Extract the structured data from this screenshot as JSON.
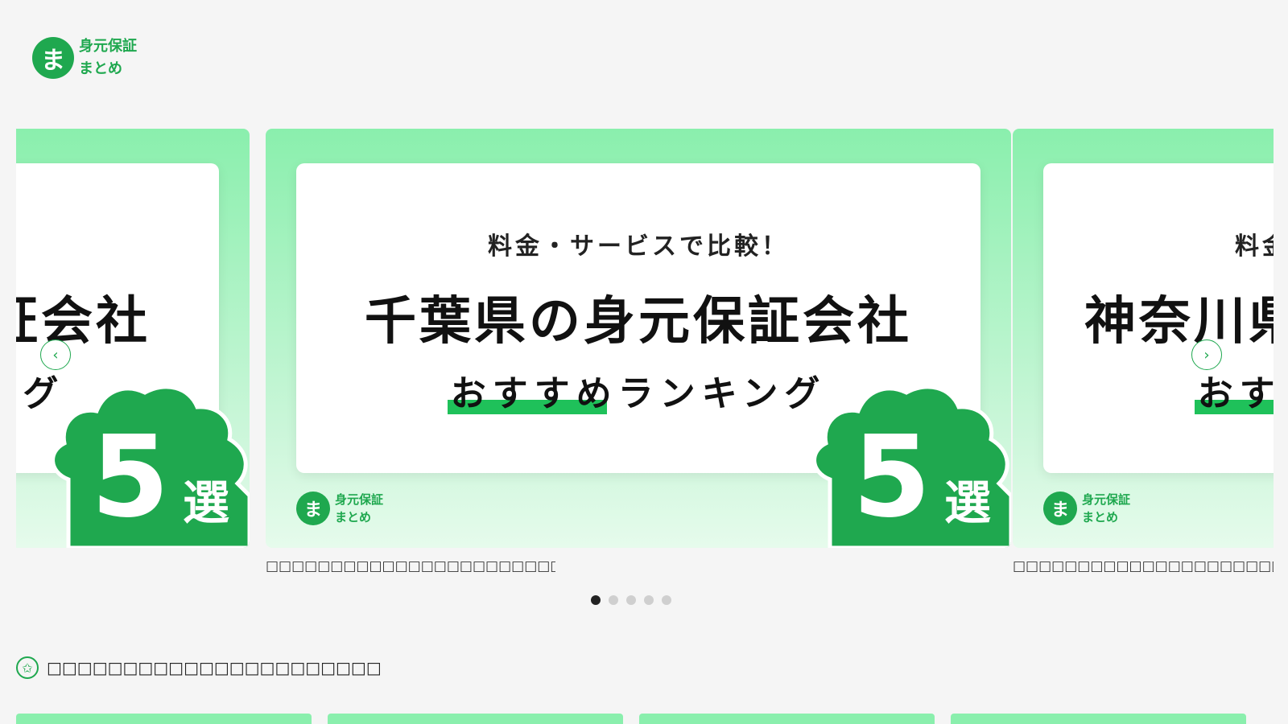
{
  "header": {
    "logo_mark": "ま",
    "logo_line1": "身元保証",
    "logo_line2": "まとめ"
  },
  "carousel": {
    "prev_icon": "‹",
    "next_icon": "›",
    "slides": [
      {
        "sub": "料金・サービスで比較！",
        "headline": "千葉県の身元保証会社",
        "ranking": "おすすめランキング",
        "badge_number": "5",
        "badge_text": "選",
        "logo_mark": "ま",
        "logo_line1": "身元保証",
        "logo_line2": "まとめ",
        "caption": "□□□□□□□□□□□□□□□□□□□□□□□□□□□□□□□□□□□□□□□□□□□"
      },
      {
        "sub": "料金・サービスで比較！",
        "headline": "千葉県の身元保証会社",
        "ranking": "おすすめランキング",
        "badge_number": "5",
        "badge_text": "選",
        "logo_mark": "ま",
        "logo_line1": "身元保証",
        "logo_line2": "まとめ",
        "caption": "□□□□□□□□□□□□□□□□□□□□□□□□□□□□□□□□□□□□□□□□□□□"
      },
      {
        "sub": "料金・サービスで比較！",
        "headline": "神奈川県の身元保証会社",
        "ranking": "おすすめランキング",
        "badge_number": "5",
        "badge_text": "選",
        "logo_mark": "ま",
        "logo_line1": "身元保証",
        "logo_line2": "まとめ",
        "caption": "□□□□□□□□□□□□□□□□□□□□□□□□□□□□□□□□□□□□□□□□□□□"
      }
    ],
    "dots": 5,
    "active_dot": 0
  },
  "section": {
    "icon": "✩",
    "title": "□□□□□□□□□□□□□□□□□□□□□□"
  },
  "colors": {
    "brand_green": "#1fa84f",
    "card_green": "#8aefad",
    "highlight": "#1fc15a"
  }
}
